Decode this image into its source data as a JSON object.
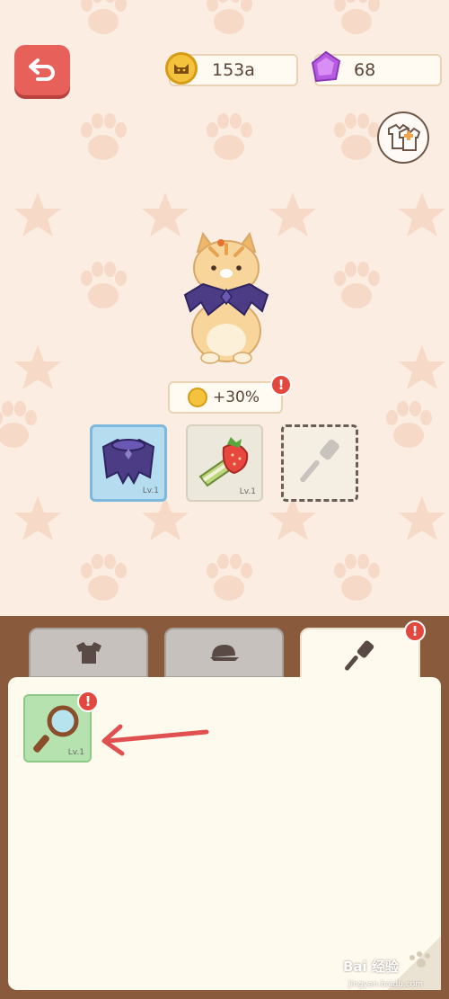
{
  "header": {
    "coins": "153a",
    "gems": "68"
  },
  "bonus": {
    "text": "+30%",
    "alert": "!"
  },
  "equipped": [
    {
      "level": "Lv.1"
    },
    {
      "level": "Lv.1"
    }
  ],
  "tabs": {
    "alert": "!"
  },
  "items": [
    {
      "level": "Lv.1",
      "alert": "!"
    }
  ],
  "watermark": {
    "brand": "Bai 经验",
    "url": "jingyan.baidu.com"
  },
  "colors": {
    "back_button": "#e7605a",
    "alert": "#e2483d",
    "selected_slot": "#b6dcf0",
    "item_slot": "#b6e2b0",
    "panel": "#8a5a3d"
  },
  "icons": {
    "back": "return-arrow-icon",
    "coin": "cat-coin-icon",
    "gem": "purple-gem-icon",
    "wardrobe": "outfit-swap-icon",
    "tab1": "shirt-icon",
    "tab2": "cap-icon",
    "tab3": "spatula-icon"
  }
}
